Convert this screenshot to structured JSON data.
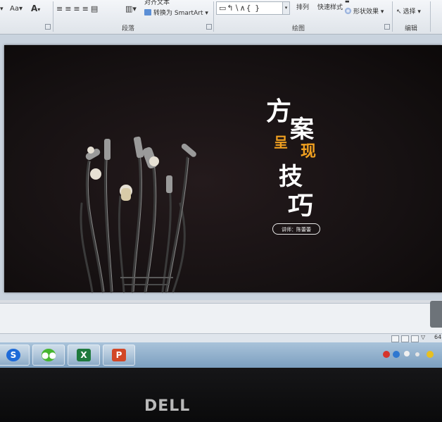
{
  "ribbon": {
    "font_aa": "Aa",
    "text_align_text": "对齐文本",
    "convert_smartart": "转换为 SmartArt",
    "arrange": "排列",
    "quick_styles": "快速样式",
    "shape_effects": "形状效果",
    "select": "选择",
    "group_paragraph": "段落",
    "group_drawing": "绘图",
    "group_editing": "编辑"
  },
  "slide": {
    "title_chars": [
      "方",
      "案",
      "呈",
      "现",
      "技",
      "巧"
    ],
    "lecturer": "讲师：陈蕾蕾",
    "accent_color": "#f0a020",
    "title_color": "#ffffff"
  },
  "status": {
    "zoom": "64"
  },
  "taskbar": {
    "apps": [
      {
        "name": "sogou",
        "label": "S",
        "color": "#1e6ad8"
      },
      {
        "name": "wechat",
        "label": "",
        "color": "#46b52f"
      },
      {
        "name": "excel",
        "label": "X",
        "color": "#1f7a3d"
      },
      {
        "name": "powerpoint",
        "label": "P",
        "color": "#d24726"
      }
    ]
  },
  "bezel": {
    "brand": "DELL"
  }
}
